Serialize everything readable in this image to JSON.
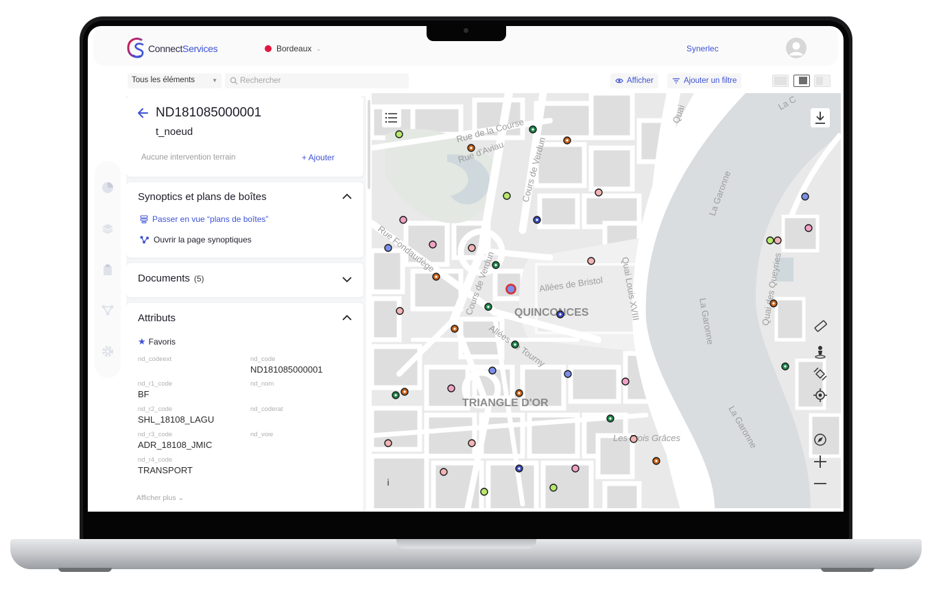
{
  "brand": {
    "name_part1": "Connect",
    "name_part2": "Services"
  },
  "header": {
    "city": "Bordeaux",
    "user": "Synerlec"
  },
  "filters": {
    "element_filter": "Tous les éléments",
    "search_placeholder": "Rechercher",
    "show_label": "Afficher",
    "add_filter_label": "Ajouter un filtre"
  },
  "node": {
    "id": "ND181085000001",
    "type": "t_noeud",
    "no_intervention": "Aucune intervention terrain",
    "add_label": "+ Ajouter"
  },
  "synoptics": {
    "title": "Synoptics et plans de boîtes",
    "link_plans": "Passer en vue “plans de boîtes”",
    "link_synoptics": "Ouvrir la page synoptiques"
  },
  "documents": {
    "title": "Documents",
    "count": "(5)"
  },
  "attributes": {
    "title": "Attributs",
    "favorites": "Favoris",
    "items": [
      {
        "key": "nd_codeext",
        "value": ""
      },
      {
        "key": "nd_code",
        "value": "ND181085000001"
      },
      {
        "key": "nd_r1_code",
        "value": "BF"
      },
      {
        "key": "nd_nom",
        "value": ""
      },
      {
        "key": "nd_r2_code",
        "value": "SHL_18108_LAGU"
      },
      {
        "key": "nd_coderat",
        "value": ""
      },
      {
        "key": "nd_r3_code",
        "value": "ADR_18108_JMIC"
      },
      {
        "key": "nd_voie",
        "value": ""
      },
      {
        "key": "nd_r4_code",
        "value": "TRANSPORT"
      }
    ],
    "show_more": "Afficher plus"
  },
  "map": {
    "labels": {
      "rue_course": "Rue de la Course",
      "rue_aviau": "Rue d'Aviau",
      "cours_verdun_1": "Cours de Verdun",
      "cours_verdun_2": "Cours de Verdun",
      "rue_fondaudege": "Rue Fondaudège",
      "allees_bristol": "Allées de Bristol",
      "quinconces": "QUINCONCES",
      "quai_louis": "Quai Louis XVIII",
      "allees_tourny": "Allées de Tourny",
      "triangle": "TRIANGLE D'OR",
      "garonne_1": "La Garonne",
      "garonne_2": "La Garonne",
      "garonne_3": "La Garonne",
      "trois_graces": "Les Trois Grâces",
      "quai_queyries": "Quai des Queyries",
      "quai_corner": "Quai",
      "corner_top": "La C"
    },
    "marker_colors": {
      "green": "#1e8a4c",
      "lime": "#b6e86a",
      "orange": "#c9641a",
      "pink": "#f0a1c4",
      "salmon": "#f3b4b4",
      "blue": "#7b8ee8",
      "navy": "#3c4cc0",
      "selected": "#d92b2b"
    },
    "info_label": "i"
  },
  "theme": {
    "accent": "#3d52d5",
    "brand_red": "#e3163f"
  }
}
